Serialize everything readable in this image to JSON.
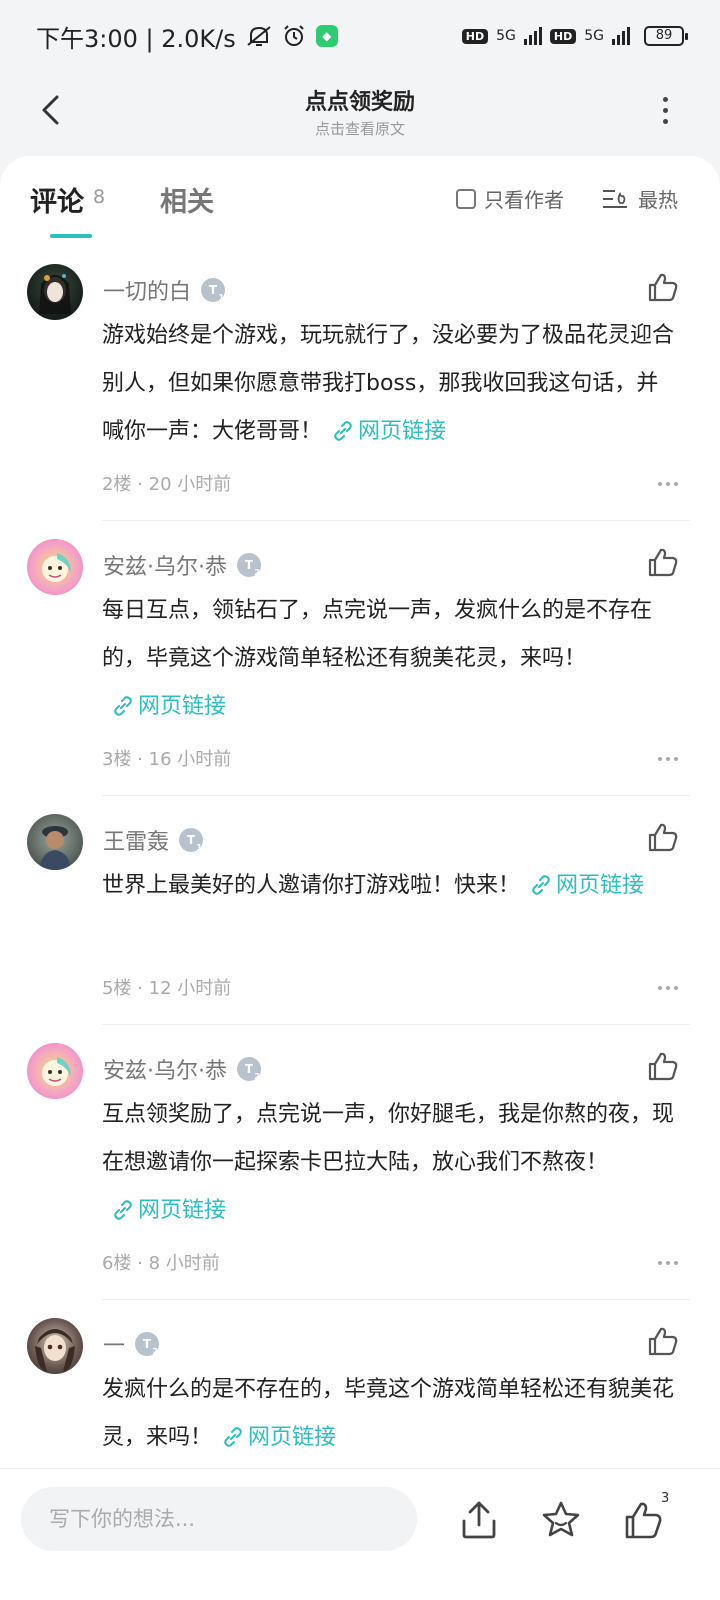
{
  "status_bar": {
    "time_speed": "下午3:00 | 2.0K/s",
    "hd1": "HD",
    "net1": "5G",
    "hd2": "HD",
    "net2": "5G",
    "battery": "89"
  },
  "header": {
    "title": "点点领奖励",
    "subtitle": "点击查看原文"
  },
  "tabs": {
    "comments_label": "评论",
    "comments_count": "8",
    "related_label": "相关",
    "author_only_label": "只看作者",
    "sort_label": "最热"
  },
  "comments": [
    {
      "name": "一切的白",
      "level": "T",
      "level_num": "1",
      "text": "游戏始终是个游戏，玩玩就行了，没必要为了极品花灵迎合别人，但如果你愿意带我打boss，那我收回我这句话，并喊你一声：大佬哥哥！",
      "link": "网页链接",
      "meta": "2楼 · 20 小时前"
    },
    {
      "name": "安兹·乌尔·恭",
      "level": "T",
      "level_num": "2",
      "text": "每日互点，领钻石了，点完说一声，发疯什么的是不存在的，毕竟这个游戏简单轻松还有貌美花灵，来吗！",
      "link": "网页链接",
      "meta": "3楼 · 16 小时前"
    },
    {
      "name": "王雷轰",
      "level": "T",
      "level_num": "1",
      "text": "世界上最美好的人邀请你打游戏啦！快来！",
      "link": "网页链接",
      "meta": "5楼 · 12 小时前"
    },
    {
      "name": "安兹·乌尔·恭",
      "level": "T",
      "level_num": "2",
      "text": "互点领奖励了，点完说一声，你好腿毛，我是你熬的夜，现在想邀请你一起探索卡巴拉大陆，放心我们不熬夜！",
      "link": "网页链接",
      "meta": "6楼 · 8 小时前"
    },
    {
      "name": "一",
      "level": "T",
      "level_num": "2",
      "text": "发疯什么的是不存在的，毕竟这个游戏简单轻松还有貌美花灵，来吗！",
      "link": "网页链接",
      "meta": ""
    }
  ],
  "bottom_bar": {
    "input_placeholder": "写下你的想法...",
    "like_count": "3"
  },
  "colors": {
    "accent": "#2bbfc1",
    "text": "#222222",
    "muted": "#999999"
  }
}
